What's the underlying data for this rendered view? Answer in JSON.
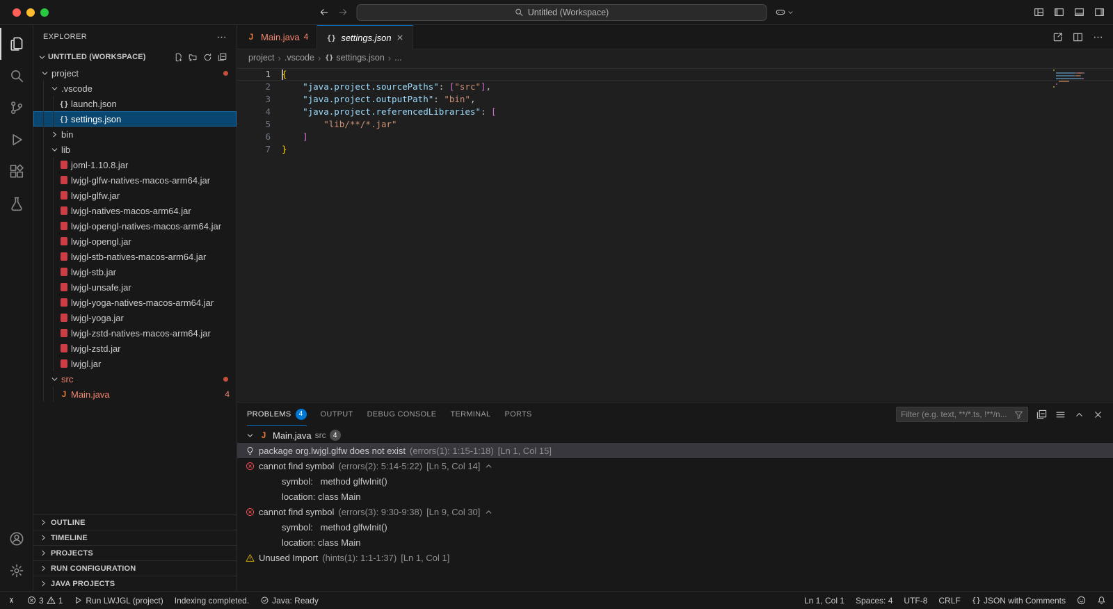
{
  "colors": {
    "accent": "#0078d4",
    "error": "#f14c4c",
    "warning": "#cca700",
    "selection": "#094771",
    "editor_bg": "#1f1f1f",
    "chrome_bg": "#181818",
    "json_key": "#9cdcfe",
    "json_string": "#ce9178",
    "brace_level1": "#ffd700",
    "bracket_level2": "#da70d6",
    "java_icon": "#e37933",
    "jar_icon": "#cc3e44"
  },
  "titlebar": {
    "search_placeholder": "Untitled (Workspace)",
    "nav_icons": [
      "back",
      "forward"
    ],
    "layout_controls": [
      "customize-layout",
      "toggle-primary-sidebar",
      "toggle-panel",
      "toggle-secondary-sidebar"
    ]
  },
  "activity_bar": {
    "items": [
      "explorer",
      "search",
      "source-control",
      "run-debug",
      "extensions",
      "testing"
    ],
    "bottom": [
      "account",
      "settings"
    ]
  },
  "explorer": {
    "title": "EXPLORER",
    "workspace_label": "UNTITLED (WORKSPACE)",
    "toolbar": [
      "new-file",
      "new-folder",
      "refresh",
      "collapse-all"
    ],
    "tree": [
      {
        "label": "project",
        "level": 0,
        "kind": "folder",
        "expanded": true,
        "dot": true
      },
      {
        "label": ".vscode",
        "level": 1,
        "kind": "folder",
        "expanded": true
      },
      {
        "label": "launch.json",
        "level": 2,
        "kind": "json"
      },
      {
        "label": "settings.json",
        "level": 2,
        "kind": "json",
        "selected": true
      },
      {
        "label": "bin",
        "level": 1,
        "kind": "folder",
        "expanded": false
      },
      {
        "label": "lib",
        "level": 1,
        "kind": "folder",
        "expanded": true
      },
      {
        "label": "joml-1.10.8.jar",
        "level": 2,
        "kind": "jar"
      },
      {
        "label": "lwjgl-glfw-natives-macos-arm64.jar",
        "level": 2,
        "kind": "jar"
      },
      {
        "label": "lwjgl-glfw.jar",
        "level": 2,
        "kind": "jar"
      },
      {
        "label": "lwjgl-natives-macos-arm64.jar",
        "level": 2,
        "kind": "jar"
      },
      {
        "label": "lwjgl-opengl-natives-macos-arm64.jar",
        "level": 2,
        "kind": "jar"
      },
      {
        "label": "lwjgl-opengl.jar",
        "level": 2,
        "kind": "jar"
      },
      {
        "label": "lwjgl-stb-natives-macos-arm64.jar",
        "level": 2,
        "kind": "jar"
      },
      {
        "label": "lwjgl-stb.jar",
        "level": 2,
        "kind": "jar"
      },
      {
        "label": "lwjgl-unsafe.jar",
        "level": 2,
        "kind": "jar"
      },
      {
        "label": "lwjgl-yoga-natives-macos-arm64.jar",
        "level": 2,
        "kind": "jar"
      },
      {
        "label": "lwjgl-yoga.jar",
        "level": 2,
        "kind": "jar"
      },
      {
        "label": "lwjgl-zstd-natives-macos-arm64.jar",
        "level": 2,
        "kind": "jar"
      },
      {
        "label": "lwjgl-zstd.jar",
        "level": 2,
        "kind": "jar"
      },
      {
        "label": "lwjgl.jar",
        "level": 2,
        "kind": "jar"
      },
      {
        "label": "src",
        "level": 1,
        "kind": "folder",
        "expanded": true,
        "dot": true,
        "error": true
      },
      {
        "label": "Main.java",
        "level": 2,
        "kind": "java",
        "error": true,
        "badge": "4"
      }
    ],
    "sections": [
      "OUTLINE",
      "TIMELINE",
      "PROJECTS",
      "RUN CONFIGURATION",
      "JAVA PROJECTS"
    ]
  },
  "editor": {
    "tabs": [
      {
        "label": "Main.java",
        "badge": "4",
        "kind": "java",
        "state": "error"
      },
      {
        "label": "settings.json",
        "kind": "json",
        "active": true,
        "preview": true
      }
    ],
    "actions": [
      "open-settings-ui",
      "split-editor",
      "more-actions"
    ],
    "breadcrumb": [
      {
        "label": "project"
      },
      {
        "label": ".vscode"
      },
      {
        "label": "settings.json",
        "icon": "json"
      },
      {
        "label": "..."
      }
    ],
    "code": {
      "language": "jsonc",
      "lines": [
        {
          "n": 1,
          "active": true,
          "tokens": [
            {
              "t": "{",
              "c": "b1"
            }
          ]
        },
        {
          "n": 2,
          "tokens": [
            {
              "t": "    ",
              "c": "ws"
            },
            {
              "t": "\"java.project.sourcePaths\"",
              "c": "key"
            },
            {
              "t": ": ",
              "c": "pun"
            },
            {
              "t": "[",
              "c": "b2"
            },
            {
              "t": "\"src\"",
              "c": "str"
            },
            {
              "t": "]",
              "c": "b2"
            },
            {
              "t": ",",
              "c": "pun"
            }
          ]
        },
        {
          "n": 3,
          "tokens": [
            {
              "t": "    ",
              "c": "ws"
            },
            {
              "t": "\"java.project.outputPath\"",
              "c": "key"
            },
            {
              "t": ": ",
              "c": "pun"
            },
            {
              "t": "\"bin\"",
              "c": "str"
            },
            {
              "t": ",",
              "c": "pun"
            }
          ]
        },
        {
          "n": 4,
          "tokens": [
            {
              "t": "    ",
              "c": "ws"
            },
            {
              "t": "\"java.project.referencedLibraries\"",
              "c": "key"
            },
            {
              "t": ": ",
              "c": "pun"
            },
            {
              "t": "[",
              "c": "b2"
            }
          ]
        },
        {
          "n": 5,
          "tokens": [
            {
              "t": "        ",
              "c": "ws"
            },
            {
              "t": "\"lib/**/*.jar\"",
              "c": "str"
            }
          ]
        },
        {
          "n": 6,
          "tokens": [
            {
              "t": "    ",
              "c": "ws"
            },
            {
              "t": "]",
              "c": "b2"
            }
          ]
        },
        {
          "n": 7,
          "tokens": [
            {
              "t": "}",
              "c": "b1"
            }
          ]
        }
      ]
    }
  },
  "panel": {
    "tabs": [
      {
        "label": "PROBLEMS",
        "badge": "4",
        "active": true
      },
      {
        "label": "OUTPUT"
      },
      {
        "label": "DEBUG CONSOLE"
      },
      {
        "label": "TERMINAL"
      },
      {
        "label": "PORTS"
      }
    ],
    "filter_placeholder": "Filter (e.g. text, **/*.ts, !**/n...",
    "actions": [
      "collapse-all",
      "view-as-table",
      "maximize-panel",
      "close-panel"
    ],
    "problems": {
      "file": "Main.java",
      "path": "src",
      "badge": "4",
      "items": [
        {
          "icon": "lightbulb",
          "text": "package org.lwjgl.glfw does not exist",
          "meta": "(errors(1): 1:15-1:18)",
          "loc": "[Ln 1, Col 15]",
          "selected": true
        },
        {
          "icon": "error",
          "text": "cannot find symbol",
          "meta": "(errors(2): 5:14-5:22)",
          "loc": "[Ln 5, Col 14]",
          "collapsible": true
        },
        {
          "detail": true,
          "text": "symbol:   method glfwInit()"
        },
        {
          "detail": true,
          "text": "location: class Main"
        },
        {
          "icon": "error",
          "text": "cannot find symbol",
          "meta": "(errors(3): 9:30-9:38)",
          "loc": "[Ln 9, Col 30]",
          "collapsible": true
        },
        {
          "detail": true,
          "text": "symbol:   method glfwInit()"
        },
        {
          "detail": true,
          "text": "location: class Main"
        },
        {
          "icon": "warning",
          "text": "Unused Import",
          "meta": "(hints(1): 1:1-1:37)",
          "loc": "[Ln 1, Col 1]"
        }
      ]
    }
  },
  "statusbar": {
    "left": [
      {
        "icon": "remote",
        "name": "remote-indicator"
      },
      {
        "icon": "error",
        "text": "3",
        "icon2": "warning",
        "text2": "1",
        "name": "problems-status"
      },
      {
        "icon": "play",
        "text": "Run LWJGL (project)",
        "name": "run-task-status"
      },
      {
        "text": "Indexing completed.",
        "name": "indexing-status"
      },
      {
        "icon": "check-circle",
        "text": "Java: Ready",
        "name": "java-ready-status"
      }
    ],
    "right": [
      {
        "text": "Ln 1, Col 1",
        "name": "cursor-position"
      },
      {
        "text": "Spaces: 4",
        "name": "indentation"
      },
      {
        "text": "UTF-8",
        "name": "encoding"
      },
      {
        "text": "CRLF",
        "name": "eol"
      },
      {
        "icon": "braces",
        "text": "JSON with Comments",
        "name": "language-mode"
      },
      {
        "icon": "feedback",
        "name": "feedback"
      },
      {
        "icon": "bell",
        "name": "notifications"
      }
    ]
  }
}
